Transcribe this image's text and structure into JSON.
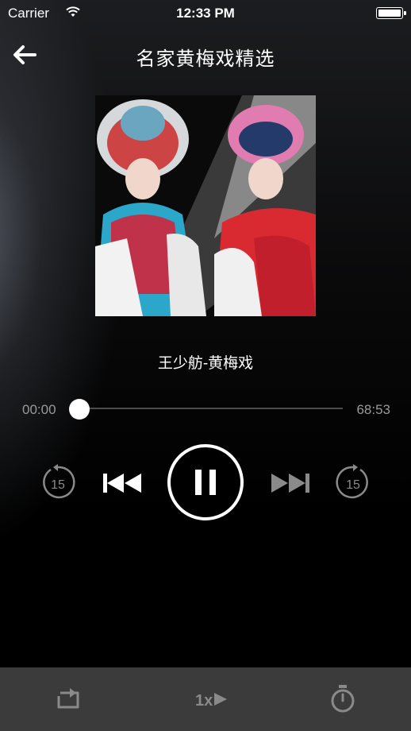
{
  "status_bar": {
    "carrier": "Carrier",
    "time": "12:33 PM"
  },
  "header": {
    "title": "名家黄梅戏精选"
  },
  "player": {
    "track_title": "王少舫-黄梅戏",
    "current_time": "00:00",
    "total_time": "68:53",
    "progress": 0,
    "skip_back_seconds": "15",
    "skip_forward_seconds": "15"
  },
  "bottom_bar": {
    "speed": "1x"
  },
  "icons": {
    "back": "arrow-left-icon",
    "rewind": "rewind-15-icon",
    "previous": "previous-track-icon",
    "pause": "pause-icon",
    "next": "next-track-icon",
    "forward": "forward-15-icon",
    "repeat": "repeat-icon",
    "speed": "play-speed-icon",
    "timer": "timer-icon"
  }
}
